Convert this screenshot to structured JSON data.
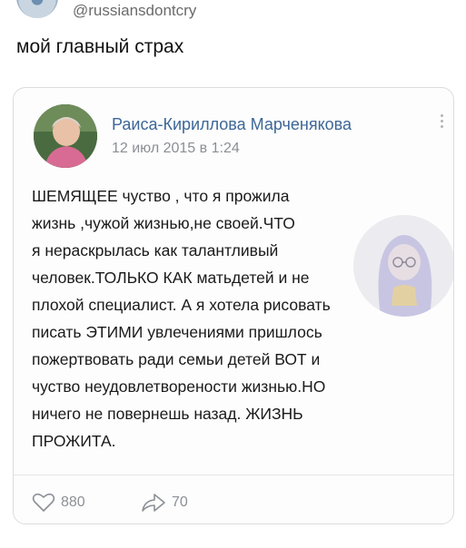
{
  "tweet": {
    "handle": "@russiansdontcry",
    "text": "мой главный страх"
  },
  "vk_post": {
    "author": "Раиса-Кириллова Марченякова",
    "date": "12 июл 2015 в 1:24",
    "lines": [
      "ШЕМЯЩЕЕ чуство , что я прожила",
      "жизнь ,чужой жизнью,не своей.ЧТО",
      "я нераскрылась как талантливый",
      "человек.ТОЛЬКО КАК матьдетей и не",
      "плохой специалист. А я хотела рисовать",
      "писать ЭТИМИ увлечениями пришлось",
      "пожертвовать ради семьи детей ВОТ и",
      "чуство неудовлетворености жизнью.НО",
      "ничего не повернешь назад. ЖИЗНЬ",
      "ПРОЖИТА."
    ],
    "likes": "880",
    "shares": "70"
  },
  "colors": {
    "name": "#3d6797",
    "meta": "#8a8f95",
    "icon": "#8b9096",
    "border": "#dcdcdc"
  },
  "icons": [
    "more-vertical-icon",
    "heart-icon",
    "share-arrow-icon"
  ]
}
